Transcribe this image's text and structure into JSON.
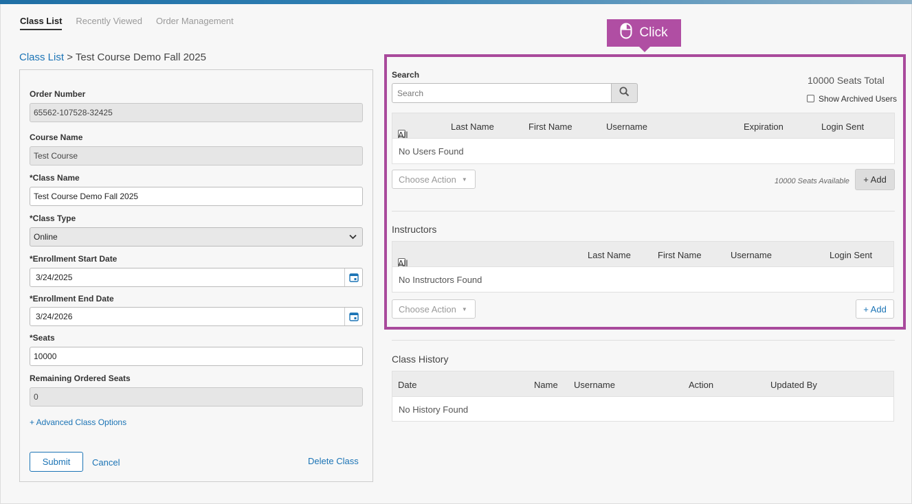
{
  "nav": {
    "tabs": [
      {
        "label": "Class List",
        "active": true
      },
      {
        "label": "Recently Viewed",
        "active": false
      },
      {
        "label": "Order Management",
        "active": false
      }
    ]
  },
  "breadcrumb": {
    "root": "Class List",
    "separator": " > ",
    "current": "Test Course Demo Fall 2025"
  },
  "form": {
    "order_number_label": "Order Number",
    "order_number_value": "65562-107528-32425",
    "course_name_label": "Course Name",
    "course_name_value": "Test Course",
    "class_name_label": "*Class Name",
    "class_name_value": "Test Course Demo Fall 2025",
    "class_type_label": "*Class Type",
    "class_type_value": "Online",
    "enroll_start_label": "*Enrollment Start Date",
    "enroll_start_value": "3/24/2025",
    "enroll_end_label": "*Enrollment End Date",
    "enroll_end_value": "3/24/2026",
    "seats_label": "*Seats",
    "seats_value": "10000",
    "remaining_label": "Remaining Ordered Seats",
    "remaining_value": "0",
    "advanced_link": "+ Advanced Class Options",
    "submit_label": "Submit",
    "cancel_label": "Cancel",
    "delete_label": "Delete Class"
  },
  "callout": {
    "label": "Click",
    "icon": "mouse-icon"
  },
  "users": {
    "search_label": "Search",
    "search_placeholder": "Search",
    "seats_total": "10000 Seats Total",
    "show_archived": "Show Archived Users",
    "columns": [
      "All",
      "Last Name",
      "First Name",
      "Username",
      "Expiration",
      "Login Sent"
    ],
    "empty": "No Users Found",
    "choose_action": "Choose Action",
    "seats_available": "10000 Seats Available",
    "add_label": "+ Add"
  },
  "instructors": {
    "title": "Instructors",
    "columns": [
      "All",
      "Last Name",
      "First Name",
      "Username",
      "Login Sent"
    ],
    "empty": "No Instructors Found",
    "choose_action": "Choose Action",
    "add_label": "+ Add"
  },
  "history": {
    "title": "Class History",
    "columns": [
      "Date",
      "Name",
      "Username",
      "Action",
      "Updated By"
    ],
    "empty": "No History Found"
  },
  "colors": {
    "accent": "#1a73b5",
    "highlight": "#a94a9c"
  }
}
